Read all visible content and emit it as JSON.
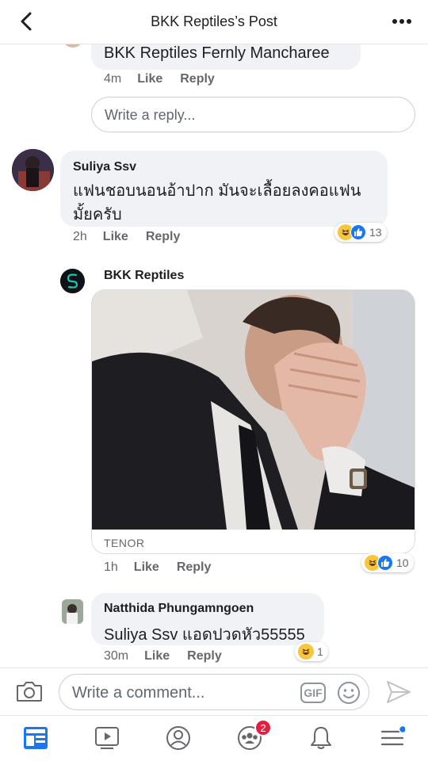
{
  "header": {
    "title": "BKK Reptiles’s Post",
    "back_icon": "back-chevron-icon",
    "more_icon": "more-dots-icon"
  },
  "comments": [
    {
      "name_top": "BKK Reptiles Fernly Mancharee",
      "time": "4m",
      "like": "Like",
      "reply": "Reply",
      "reply_placeholder": "Write a reply..."
    },
    {
      "author": "Suliya Ssv",
      "text": "แฟนชอบนอนอ้าปาก มันจะเลื้อยลงคอแฟนมั้ยครับ",
      "time": "2h",
      "like": "Like",
      "reply": "Reply",
      "reactions_count": "13"
    },
    {
      "author": "BKK Reptiles",
      "gif_source": "TENOR",
      "time": "1h",
      "like": "Like",
      "reply": "Reply",
      "reactions_count": "10"
    },
    {
      "author": "Natthida Phungamngoen",
      "text": "Suliya Ssv แอดปวดหัว55555",
      "time": "30m",
      "like": "Like",
      "reply": "Reply",
      "reactions_count": "1"
    }
  ],
  "composer": {
    "placeholder": "Write a comment...",
    "gif_label": "GIF"
  },
  "nav": {
    "groups_badge": "2"
  },
  "colors": {
    "accent": "#1877f2",
    "badge": "#e41e3f",
    "bubble": "#f0f2f5"
  }
}
